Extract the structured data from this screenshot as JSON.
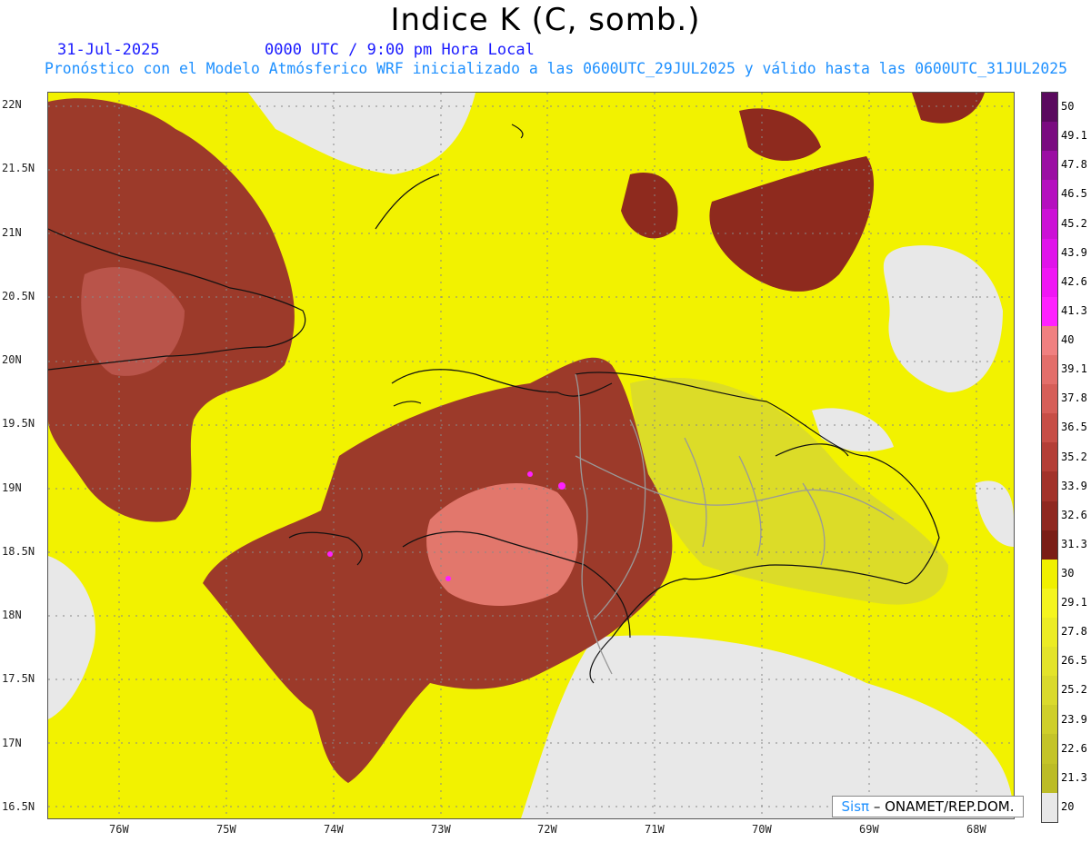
{
  "header": {
    "title": "Indice K (C, somb.)",
    "date": "31-Jul-2025",
    "time": "0000 UTC / 9:00 pm Hora Local",
    "forecast": "Pronóstico con el Modelo Atmósferico WRF inicializado a las 0600UTC_29JUL2025 y válido hasta las  0600UTC_31JUL2025"
  },
  "lat_labels": [
    "22N",
    "21.5N",
    "21N",
    "20.5N",
    "20N",
    "19.5N",
    "19N",
    "18.5N",
    "18N",
    "17.5N",
    "17N",
    "16.5N"
  ],
  "lon_labels": [
    "76W",
    "75W",
    "74W",
    "73W",
    "72W",
    "71W",
    "70W",
    "69W",
    "68W"
  ],
  "colorbar": {
    "levels": [
      "50",
      "49.1",
      "47.8",
      "46.5",
      "45.2",
      "43.9",
      "42.6",
      "41.3",
      "40",
      "39.1",
      "37.8",
      "36.5",
      "35.2",
      "33.9",
      "32.6",
      "31.3",
      "30",
      "29.1",
      "27.8",
      "26.5",
      "25.2",
      "23.9",
      "22.6",
      "21.3",
      "20"
    ],
    "colors": [
      "#5a0a5e",
      "#7a0c80",
      "#9b0ea3",
      "#b50fbf",
      "#cc10d6",
      "#e012ea",
      "#f015f5",
      "#ff20ff",
      "#f08080",
      "#e36e6a",
      "#d65e58",
      "#c74e46",
      "#b43e36",
      "#a2322a",
      "#8f2820",
      "#7a1e16",
      "#f0f000",
      "#f5f51e",
      "#ecec24",
      "#e4e42a",
      "#dada2c",
      "#cfcf2a",
      "#c4c428",
      "#bcbc26",
      "#e8e8e8"
    ]
  },
  "credit": {
    "sis": "Sisπ",
    "rest": " – ONAMET/REP.DOM."
  }
}
